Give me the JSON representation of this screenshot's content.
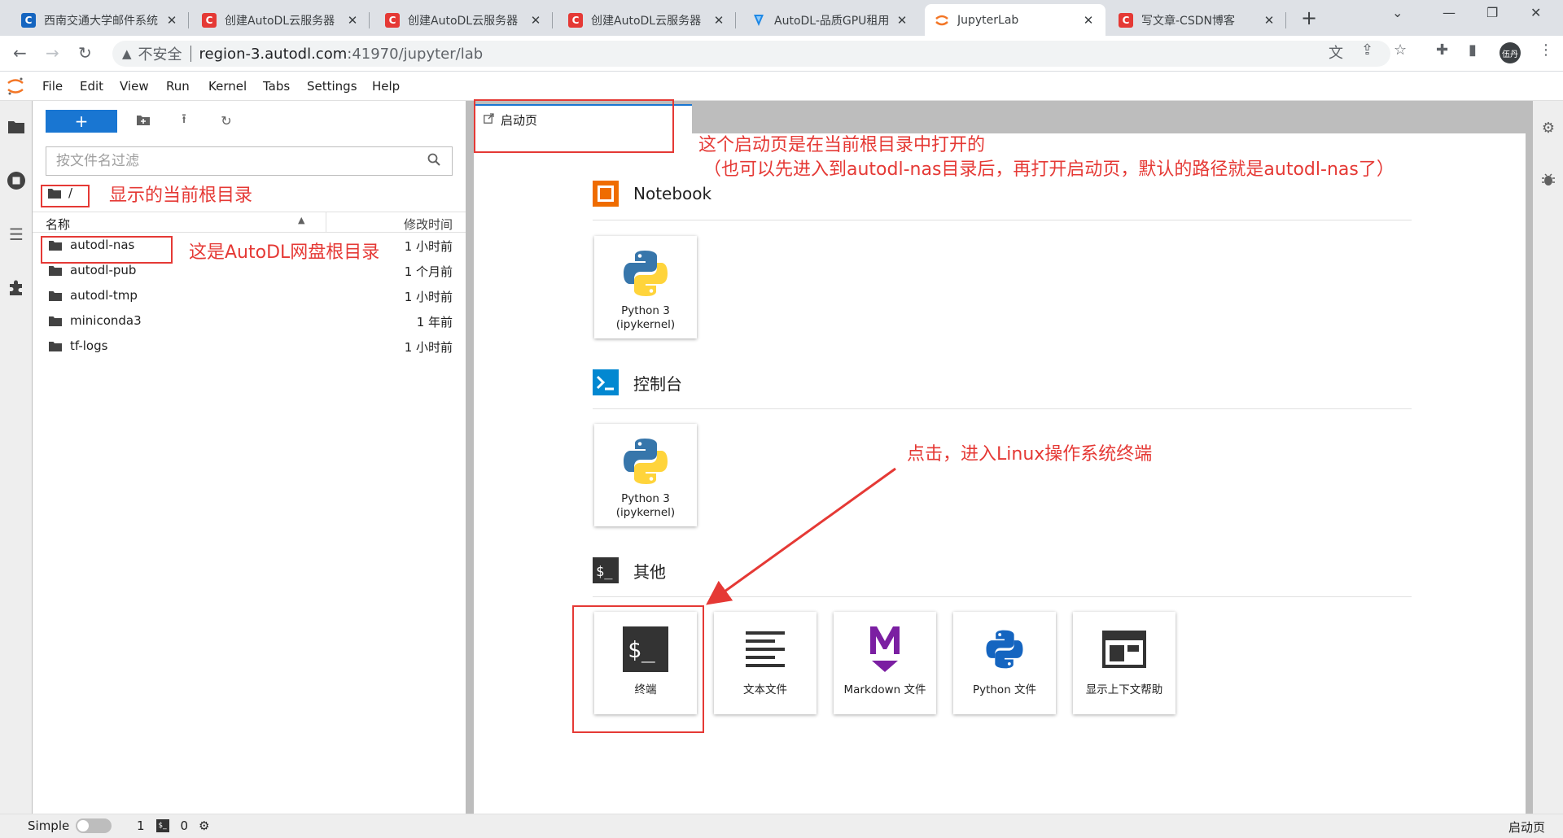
{
  "browser": {
    "tabs": [
      {
        "title": "西南交通大学邮件系统",
        "favicon": "C",
        "favicon_color": "#1565c0"
      },
      {
        "title": "创建AutoDL云服务器",
        "favicon": "C",
        "favicon_color": "#e53935"
      },
      {
        "title": "创建AutoDL云服务器",
        "favicon": "C",
        "favicon_color": "#e53935"
      },
      {
        "title": "创建AutoDL云服务器",
        "favicon": "C",
        "favicon_color": "#e53935"
      },
      {
        "title": "AutoDL-品质GPU租用",
        "favicon": "autodl-icon",
        "favicon_color": "#1e88e5"
      },
      {
        "title": "JupyterLab",
        "favicon": "jupyter-icon",
        "favicon_color": "#f37626",
        "active": true
      },
      {
        "title": "写文章-CSDN博客",
        "favicon": "C",
        "favicon_color": "#e53935"
      }
    ],
    "security_label": "不安全",
    "url_host": "region-3.autodl.com",
    "url_path": ":41970/jupyter/lab",
    "profile_label": "伍丹"
  },
  "menubar": {
    "items": [
      "File",
      "Edit",
      "View",
      "Run",
      "Kernel",
      "Tabs",
      "Settings",
      "Help"
    ]
  },
  "filebrowser": {
    "new_label": "+",
    "filter_placeholder": "按文件名过滤",
    "breadcrumb": "/",
    "header_name": "名称",
    "header_modified": "修改时间",
    "files": [
      {
        "name": "autodl-nas",
        "modified": "1 小时前"
      },
      {
        "name": "autodl-pub",
        "modified": "1 个月前"
      },
      {
        "name": "autodl-tmp",
        "modified": "1 小时前"
      },
      {
        "name": "miniconda3",
        "modified": "1 年前"
      },
      {
        "name": "tf-logs",
        "modified": "1 小时前"
      }
    ]
  },
  "launcher": {
    "tab_label": "启动页",
    "sections": {
      "notebook": {
        "title": "Notebook",
        "cards": [
          {
            "line1": "Python 3",
            "line2": "(ipykernel)"
          }
        ]
      },
      "console": {
        "title": "控制台",
        "cards": [
          {
            "line1": "Python 3",
            "line2": "(ipykernel)"
          }
        ]
      },
      "other": {
        "title": "其他",
        "cards": [
          {
            "label": "终端"
          },
          {
            "label": "文本文件"
          },
          {
            "label": "Markdown 文件"
          },
          {
            "label": "Python 文件"
          },
          {
            "label": "显示上下文帮助"
          }
        ]
      }
    }
  },
  "statusbar": {
    "simple_label": "Simple",
    "kernels_count": "1",
    "terminals_count": "0",
    "right_label": "启动页"
  },
  "annotations": {
    "current_dir": "显示的当前根目录",
    "nas_root": "这是AutoDL网盘根目录",
    "launcher_line1": "这个启动页是在当前根目录中打开的",
    "launcher_line2": "（也可以先进入到autodl-nas目录后，再打开启动页，默认的路径就是autodl-nas了）",
    "terminal_hint": "点击，进入Linux操作系统终端",
    "color": "#e53935"
  }
}
